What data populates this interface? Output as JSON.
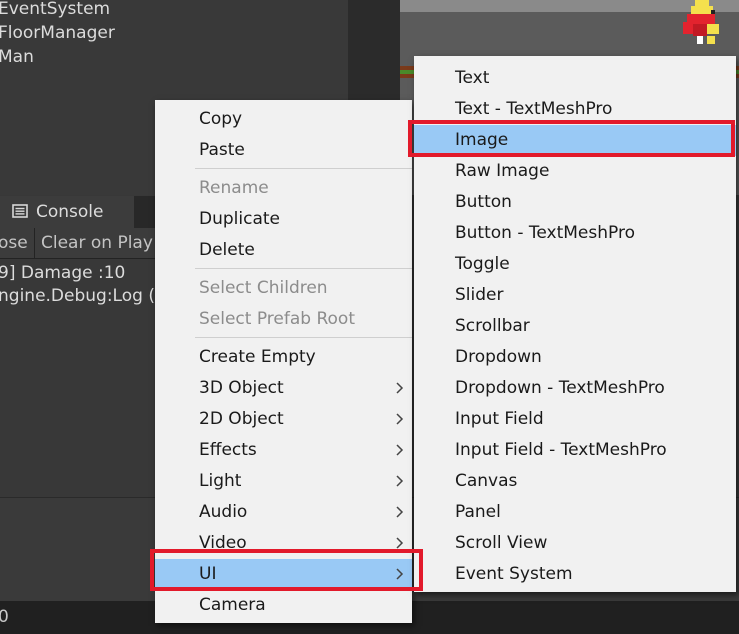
{
  "hierarchy": {
    "items": [
      "EventSystem",
      "FloorManager",
      "Man"
    ]
  },
  "console": {
    "tab_label": "Console",
    "tab_icon": "console-list-icon",
    "toolbar": {
      "collapse_label": "ose",
      "clear_on_play_label": "Clear on Play"
    },
    "log_lines": [
      "9] Damage :10",
      "ngine.Debug:Log ("
    ]
  },
  "status_bar": {
    "text": "0"
  },
  "context_menu": {
    "items": {
      "copy": "Copy",
      "paste": "Paste",
      "rename": "Rename",
      "duplicate": "Duplicate",
      "delete": "Delete",
      "select_children": "Select Children",
      "select_prefab_root": "Select Prefab Root",
      "create_empty": "Create Empty",
      "object_3d": "3D Object",
      "object_2d": "2D Object",
      "effects": "Effects",
      "light": "Light",
      "audio": "Audio",
      "video": "Video",
      "ui": "UI",
      "camera": "Camera"
    },
    "disabled": [
      "Rename",
      "Select Children",
      "Select Prefab Root"
    ],
    "highlighted": "UI"
  },
  "ui_submenu": {
    "items": [
      "Text",
      "Text - TextMeshPro",
      "Image",
      "Raw Image",
      "Button",
      "Button - TextMeshPro",
      "Toggle",
      "Slider",
      "Scrollbar",
      "Dropdown",
      "Dropdown - TextMeshPro",
      "Input Field",
      "Input Field - TextMeshPro",
      "Canvas",
      "Panel",
      "Scroll View",
      "Event System"
    ],
    "highlighted": "Image"
  },
  "colors": {
    "menu_background": "#f1f1f1",
    "highlight": "#99c9f5",
    "annotation_red": "#e21a2b",
    "editor_dark": "#383838"
  }
}
